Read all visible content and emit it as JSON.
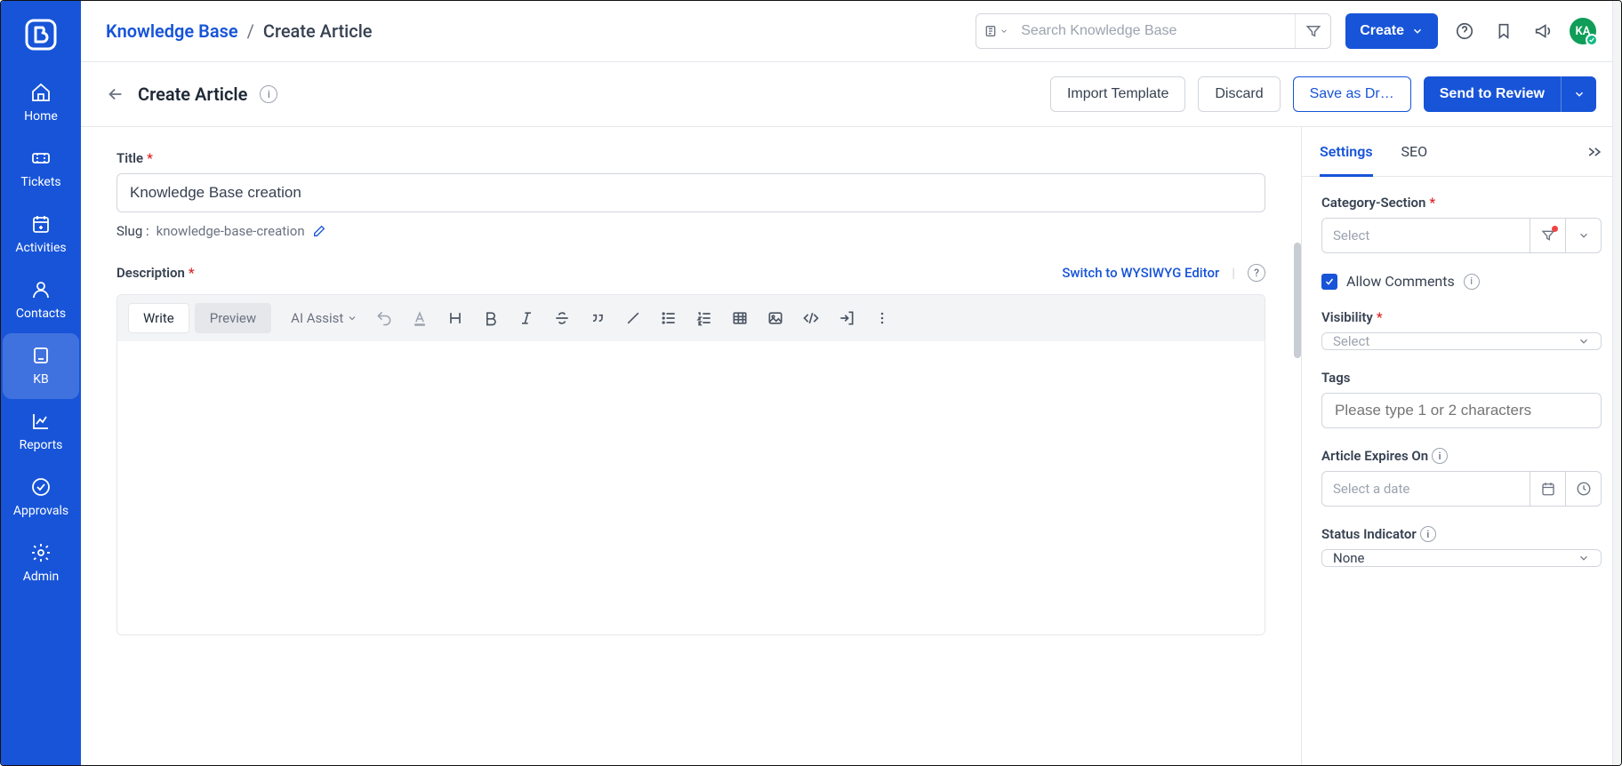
{
  "sidebar": {
    "items": [
      {
        "label": "Home"
      },
      {
        "label": "Tickets"
      },
      {
        "label": "Activities"
      },
      {
        "label": "Contacts"
      },
      {
        "label": "KB"
      },
      {
        "label": "Reports"
      },
      {
        "label": "Approvals"
      },
      {
        "label": "Admin"
      }
    ]
  },
  "breadcrumb": {
    "root": "Knowledge Base",
    "current": "Create Article"
  },
  "search": {
    "placeholder": "Search Knowledge Base"
  },
  "topbar": {
    "create": "Create",
    "avatar": "KA"
  },
  "action": {
    "page_title": "Create Article",
    "import": "Import Template",
    "discard": "Discard",
    "save_draft": "Save as Dr…",
    "send_review": "Send to Review"
  },
  "editor": {
    "title_label": "Title",
    "title_value": "Knowledge Base creation",
    "slug_label": "Slug :",
    "slug_value": "knowledge-base-creation",
    "desc_label": "Description",
    "switch_link": "Switch to WYSIWYG Editor",
    "tab_write": "Write",
    "tab_preview": "Preview",
    "ai_assist": "AI Assist"
  },
  "settings": {
    "tab_settings": "Settings",
    "tab_seo": "SEO",
    "category_label": "Category-Section",
    "select_placeholder": "Select",
    "allow_comments": "Allow Comments",
    "visibility_label": "Visibility",
    "tags_label": "Tags",
    "tags_placeholder": "Please type 1 or 2 characters",
    "expires_label": "Article Expires On",
    "expires_placeholder": "Select a date",
    "status_label": "Status Indicator",
    "status_value": "None"
  }
}
